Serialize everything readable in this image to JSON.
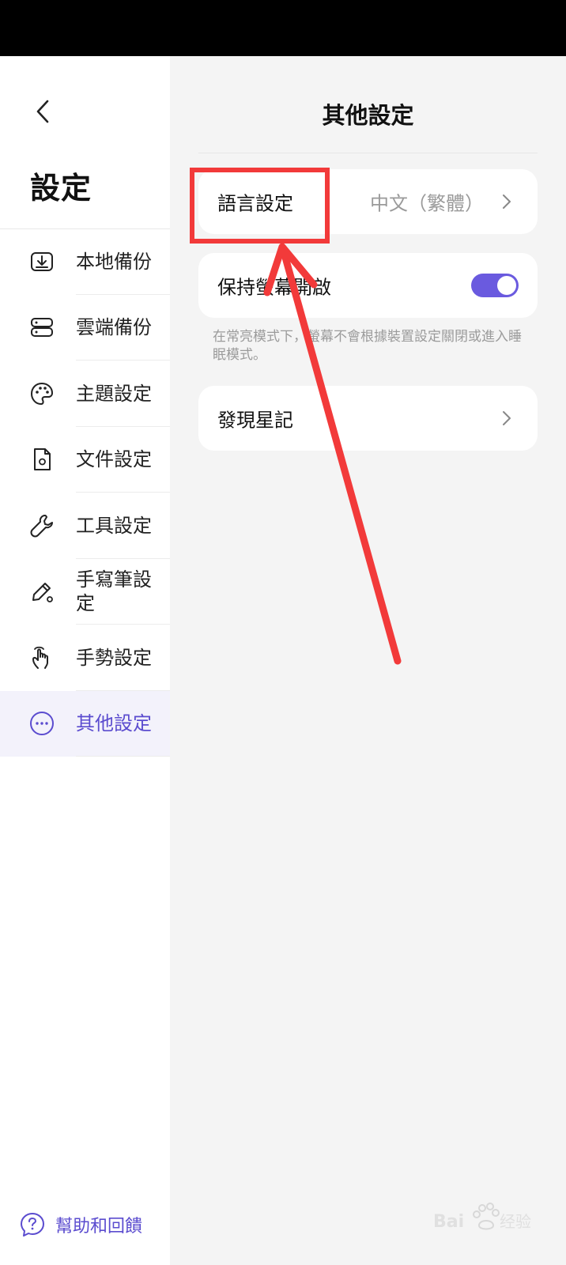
{
  "sidebar": {
    "title": "設定",
    "items": [
      {
        "label": "本地備份",
        "icon": "local-backup-icon"
      },
      {
        "label": "雲端備份",
        "icon": "cloud-backup-icon"
      },
      {
        "label": "主題設定",
        "icon": "palette-icon"
      },
      {
        "label": "文件設定",
        "icon": "document-settings-icon"
      },
      {
        "label": "工具設定",
        "icon": "wrench-icon"
      },
      {
        "label": "手寫筆設定",
        "icon": "pen-settings-icon"
      },
      {
        "label": "手勢設定",
        "icon": "gesture-icon"
      },
      {
        "label": "其他設定",
        "icon": "more-icon",
        "active": true
      }
    ],
    "help_label": "幫助和回饋"
  },
  "main": {
    "title": "其他設定",
    "language": {
      "label": "語言設定",
      "value": "中文（繁體）"
    },
    "keep_screen_on": {
      "label": "保持螢幕開啟",
      "enabled": true,
      "description": "在常亮模式下，螢幕不會根據裝置設定關閉或進入睡眠模式。"
    },
    "discover": {
      "label": "發現星記"
    }
  },
  "colors": {
    "accent": "#5b4ccf",
    "annotation": "#f23a3a",
    "panel_bg": "#f4f4f4"
  }
}
